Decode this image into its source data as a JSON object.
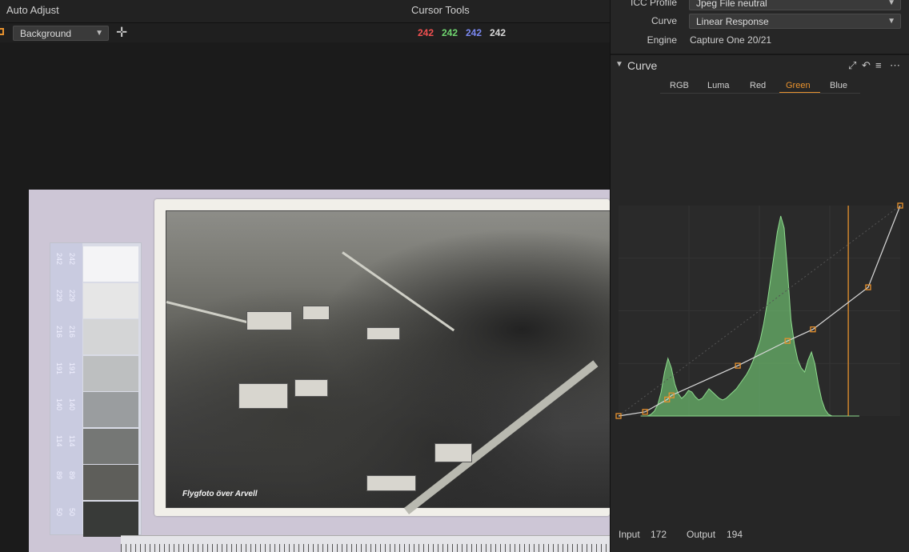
{
  "topbar": {
    "auto_adjust": "Auto Adjust",
    "cursor_tools": "Cursor Tools"
  },
  "toolrow": {
    "layer_select": "Background",
    "add_icon": "plus-icon",
    "rgb": {
      "r": "242",
      "g": "242",
      "b": "242",
      "l": "242"
    }
  },
  "colors": {
    "accent": "#e8922e",
    "red": "#f05050",
    "green": "#6fd46f",
    "blue": "#7a88f0",
    "histogram": "#69b46b"
  },
  "panel": {
    "icc_label": "ICC Profile",
    "icc_value": "Jpeg File neutral",
    "curve_label": "Curve",
    "curve_value": "Linear Response",
    "engine_label": "Engine",
    "engine_value": "Capture One 20/21"
  },
  "curve_tool": {
    "title": "Curve",
    "tabs": [
      "RGB",
      "Luma",
      "Red",
      "Green",
      "Blue"
    ],
    "active_tab": "Green",
    "input_label": "Input",
    "input_value": "172",
    "output_label": "Output",
    "output_value": "194",
    "points": [
      [
        0,
        0
      ],
      [
        24,
        5
      ],
      [
        44,
        20
      ],
      [
        48,
        25
      ],
      [
        108,
        61
      ],
      [
        153,
        91
      ],
      [
        176,
        105
      ],
      [
        226,
        156
      ],
      [
        255,
        255
      ]
    ],
    "cursor_input": 208
  },
  "photo": {
    "caption": "Flygfoto över Arvell",
    "gray_card_values": [
      "242",
      "229",
      "216",
      "191",
      "140",
      "114",
      "89",
      "50"
    ],
    "gray_card_colors": [
      "#f4f4f6",
      "#e6e6e6",
      "#d4d5d6",
      "#bdbfc0",
      "#9a9d9f",
      "#757775",
      "#5e5e5a",
      "#383a38"
    ]
  }
}
